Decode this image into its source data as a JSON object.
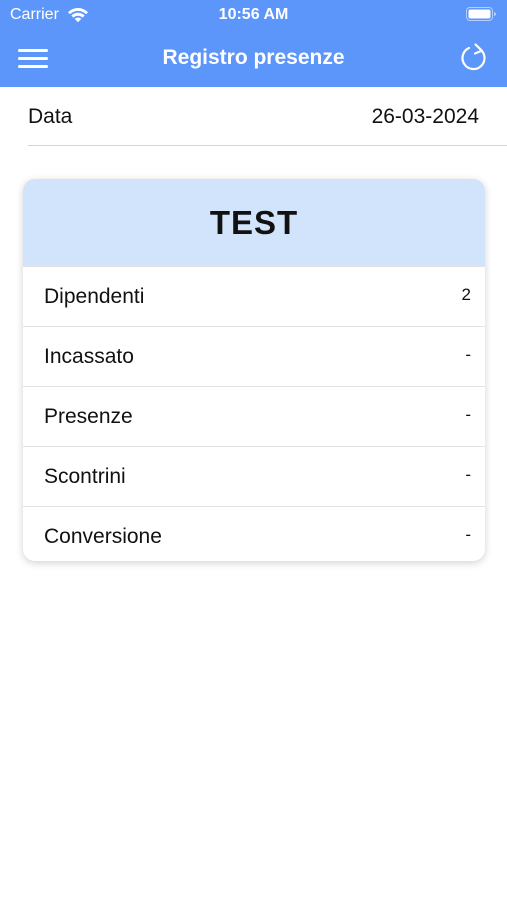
{
  "status_bar": {
    "carrier": "Carrier",
    "time": "10:56 AM",
    "wifi_icon": "wifi-icon",
    "battery_icon": "battery-icon"
  },
  "navbar": {
    "title": "Registro presenze",
    "menu_icon": "hamburger-menu-icon",
    "refresh_icon": "refresh-icon",
    "background_color": "#5c96fa"
  },
  "date_row": {
    "label": "Data",
    "value": "26-03-2024"
  },
  "card": {
    "title": "TEST",
    "header_color": "#d2e3fc",
    "rows": [
      {
        "label": "Dipendenti",
        "value": "2"
      },
      {
        "label": "Incassato",
        "value": "-"
      },
      {
        "label": "Presenze",
        "value": "-"
      },
      {
        "label": "Scontrini",
        "value": "-"
      },
      {
        "label": "Conversione",
        "value": "-"
      }
    ]
  }
}
